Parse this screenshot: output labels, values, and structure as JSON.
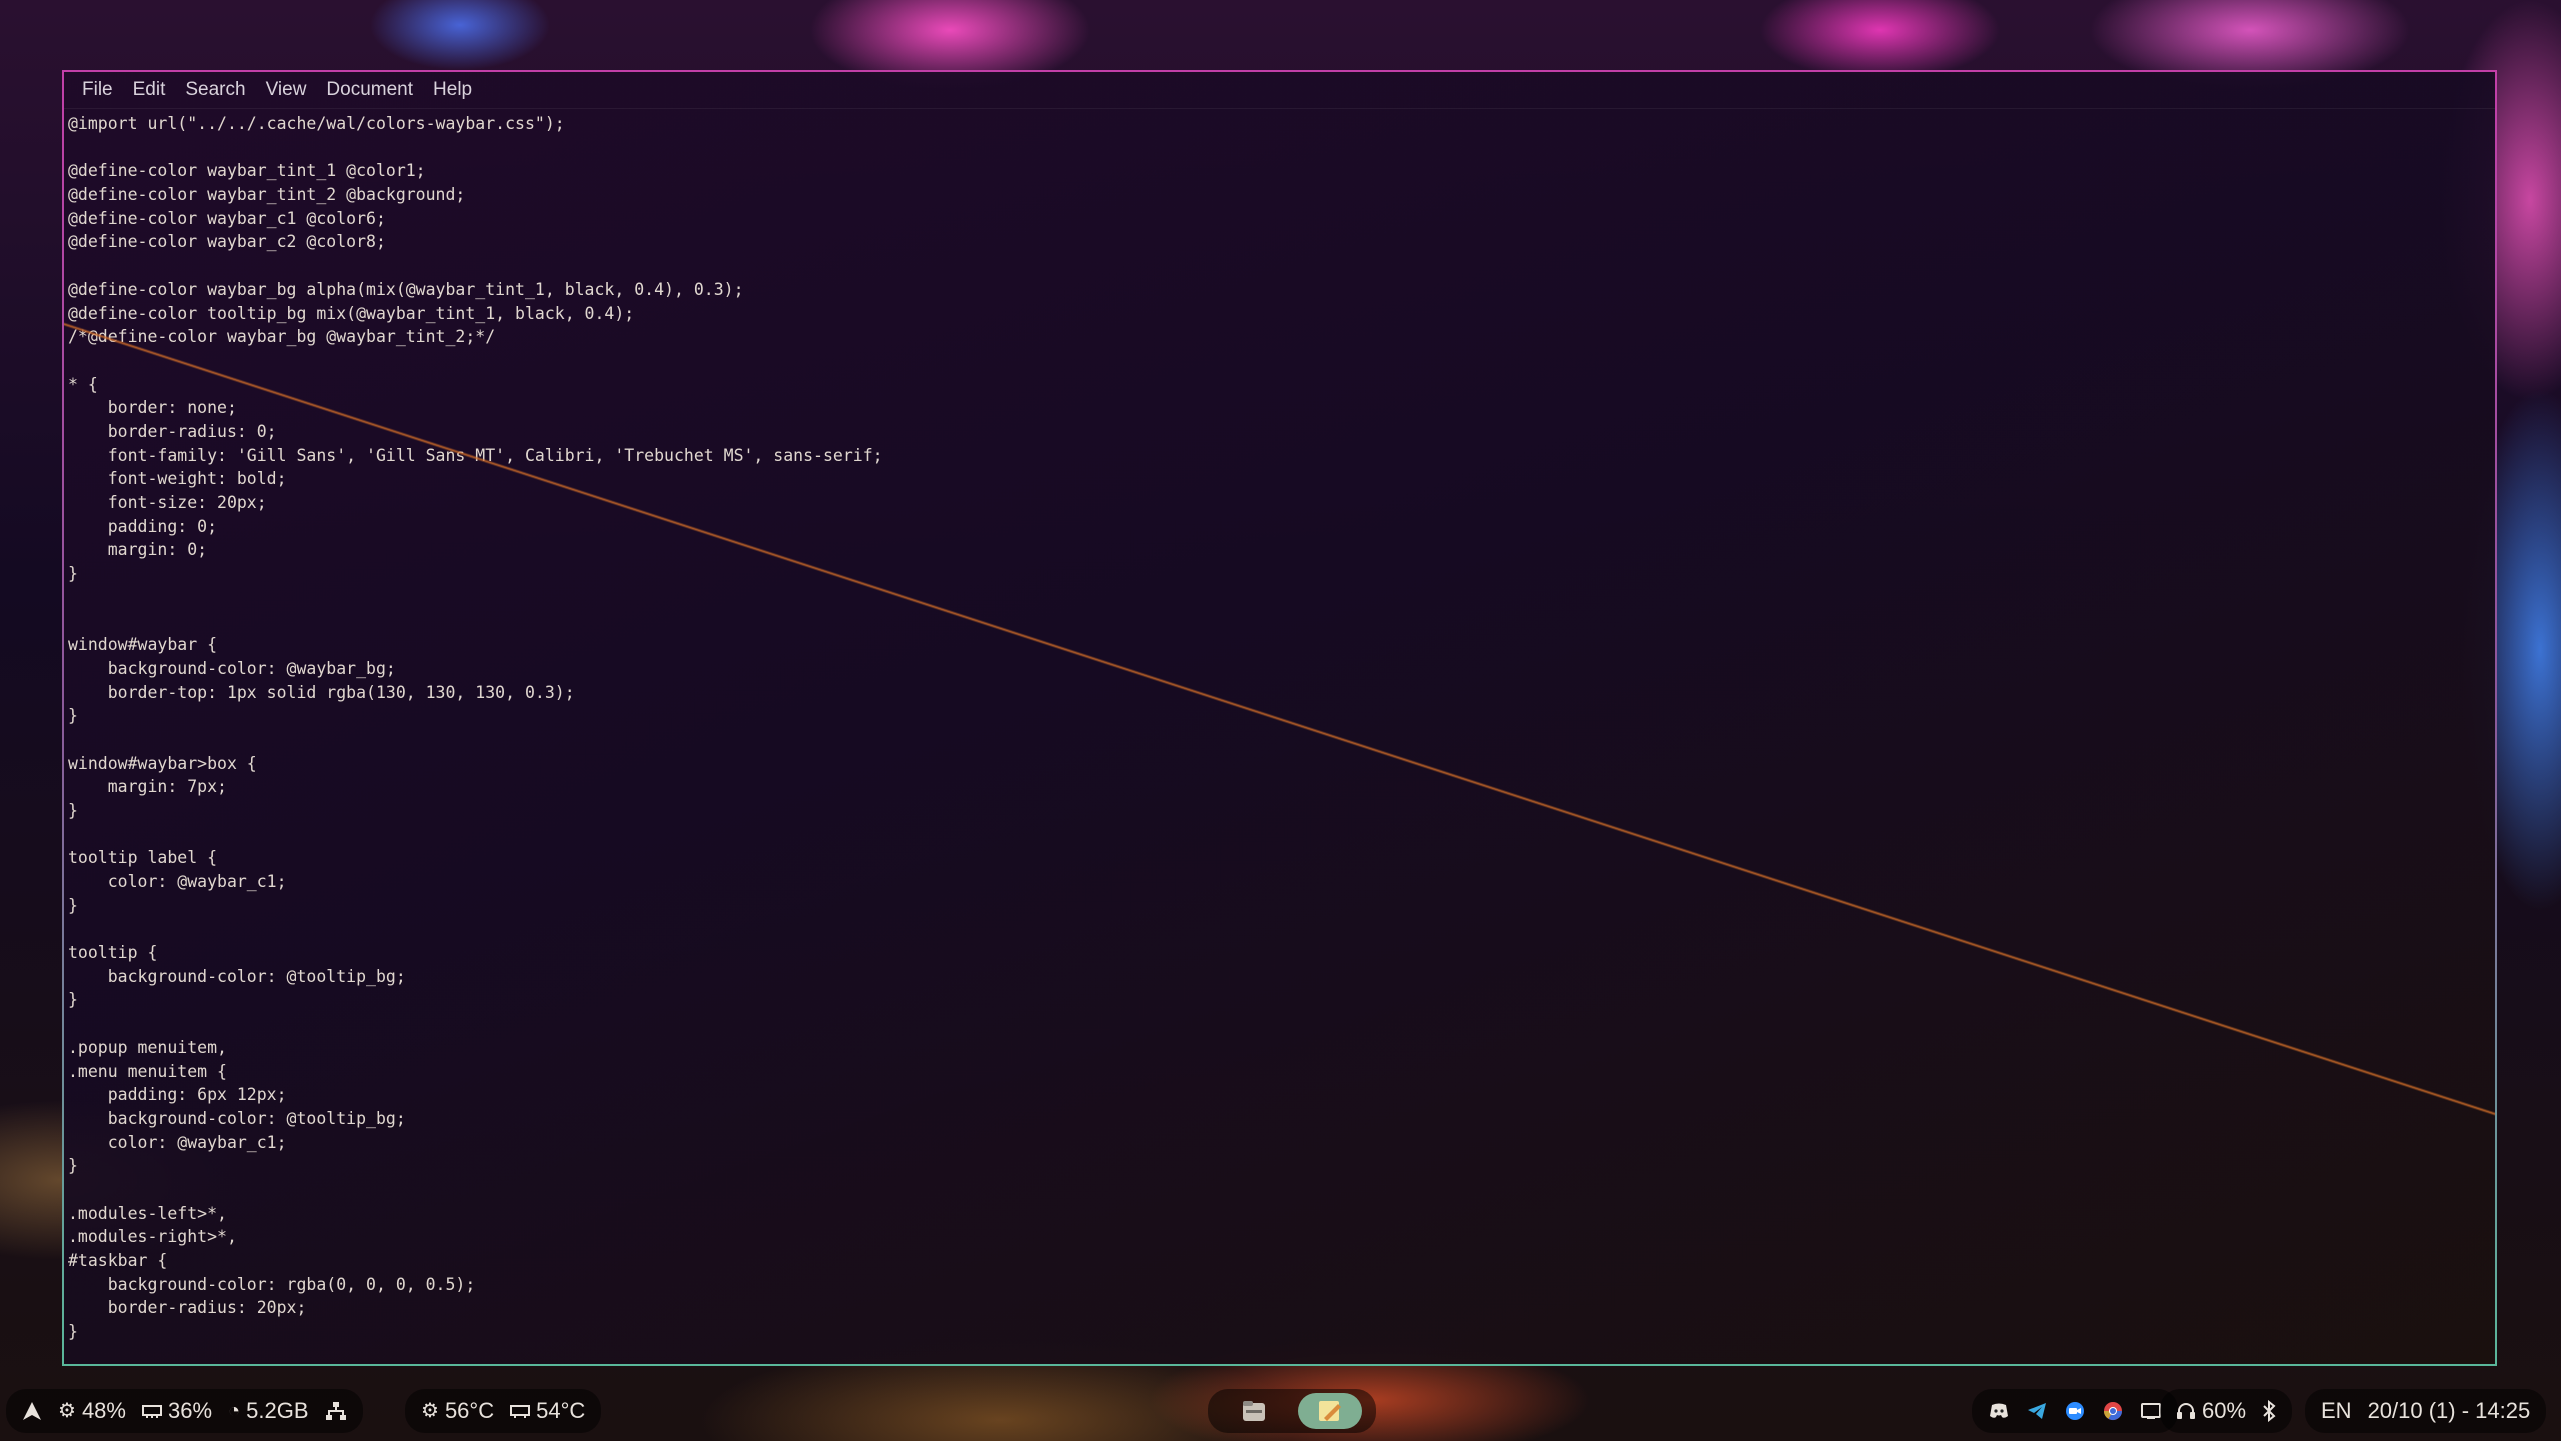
{
  "menubar": {
    "items": [
      "File",
      "Edit",
      "Search",
      "View",
      "Document",
      "Help"
    ]
  },
  "code_lines": [
    "@import url(\"../../.cache/wal/colors-waybar.css\");",
    "",
    "@define-color waybar_tint_1 @color1;",
    "@define-color waybar_tint_2 @background;",
    "@define-color waybar_c1 @color6;",
    "@define-color waybar_c2 @color8;",
    "",
    "@define-color waybar_bg alpha(mix(@waybar_tint_1, black, 0.4), 0.3);",
    "@define-color tooltip_bg mix(@waybar_tint_1, black, 0.4);",
    "/*@define-color waybar_bg @waybar_tint_2;*/",
    "",
    "* {",
    "    border: none;",
    "    border-radius: 0;",
    "    font-family: 'Gill Sans', 'Gill Sans MT', Calibri, 'Trebuchet MS', sans-serif;",
    "    font-weight: bold;",
    "    font-size: 20px;",
    "    padding: 0;",
    "    margin: 0;",
    "}",
    "",
    "",
    "window#waybar {",
    "    background-color: @waybar_bg;",
    "    border-top: 1px solid rgba(130, 130, 130, 0.3);",
    "}",
    "",
    "window#waybar>box {",
    "    margin: 7px;",
    "}",
    "",
    "tooltip label {",
    "    color: @waybar_c1;",
    "}",
    "",
    "tooltip {",
    "    background-color: @tooltip_bg;",
    "}",
    "",
    ".popup menuitem,",
    ".menu menuitem {",
    "    padding: 6px 12px;",
    "    background-color: @tooltip_bg;",
    "    color: @waybar_c1;",
    "}",
    "",
    ".modules-left>*,",
    ".modules-right>*,",
    "#taskbar {",
    "    background-color: rgba(0, 0, 0, 0.5);",
    "    border-radius: 20px;",
    "}"
  ],
  "statusbar": {
    "left": {
      "launcher_icon": "arch-icon",
      "cpu": "48%",
      "memory": "36%",
      "disk": "5.2GB",
      "network_icon": "network-icon",
      "cpu_temp": "56°C",
      "gpu_temp": "54°C"
    },
    "taskbar": {
      "apps": [
        {
          "name": "file-manager-icon",
          "active": false
        },
        {
          "name": "text-editor-icon",
          "active": true
        }
      ]
    },
    "right": {
      "tray": [
        "discord-icon",
        "telegram-icon",
        "zoom-icon",
        "chrome-icon",
        "screen-icon"
      ],
      "volume": "60%",
      "bluetooth_icon": "bluetooth-icon",
      "language": "EN",
      "clock": "20/10 (1) - 14:25"
    }
  },
  "colors": {
    "window_border_top": "#c23fa8",
    "window_border_bottom": "#5ab79a",
    "active_task": "#7fae92",
    "text": "#e0d7cf"
  }
}
